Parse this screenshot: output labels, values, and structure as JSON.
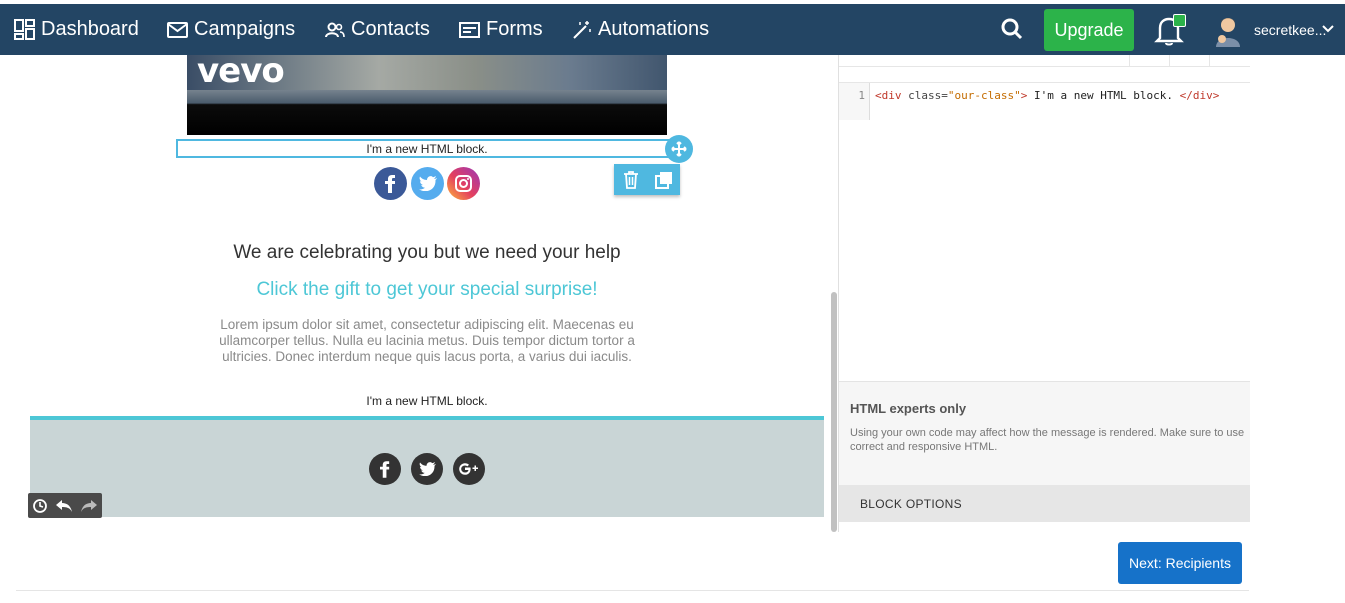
{
  "nav": {
    "items": [
      {
        "label": "Dashboard",
        "icon": "dashboard-icon"
      },
      {
        "label": "Campaigns",
        "icon": "envelope-icon"
      },
      {
        "label": "Contacts",
        "icon": "contacts-icon"
      },
      {
        "label": "Forms",
        "icon": "form-icon"
      },
      {
        "label": "Automations",
        "icon": "magic-wand-icon"
      }
    ],
    "upgrade_label": "Upgrade",
    "username": "secretkee..."
  },
  "email": {
    "hero_logo_text": "vevo",
    "html_block_1": "I'm a new HTML block.",
    "heading": "We are celebrating you but we need your help",
    "subheading": "Click the gift to get your special surprise!",
    "body_text": "Lorem ipsum dolor sit amet, consectetur adipiscing elit. Maecenas eu ullamcorper tellus. Nulla eu lacinia metus. Duis tempor dictum tortor a ultricies. Donec interdum neque quis lacus porta, a varius dui iaculis.",
    "html_block_2": "I'm a new HTML block.",
    "social_top": [
      "facebook-icon",
      "twitter-icon",
      "instagram-icon"
    ],
    "social_footer": [
      "facebook-icon",
      "twitter-icon",
      "google-plus-icon"
    ]
  },
  "code_editor": {
    "line_number": "1",
    "code_open_tag": "<div",
    "code_attr": " class=",
    "code_value": "\"our-class\"",
    "code_close_bracket": ">",
    "code_text": " I'm a new HTML block. ",
    "code_end_tag": "</div>"
  },
  "panel": {
    "experts_title": "HTML experts only",
    "experts_text": "Using your own code may affect how the message is rendered. Make sure to use correct and responsive HTML.",
    "block_options_label": "BLOCK OPTIONS"
  },
  "footer": {
    "next_label": "Next: Recipients"
  },
  "colors": {
    "topbar": "#234564",
    "upgrade": "#2cb34a",
    "accent": "#4fb8e0",
    "subheading": "#4dc7d6",
    "next_button": "#1672c9"
  }
}
